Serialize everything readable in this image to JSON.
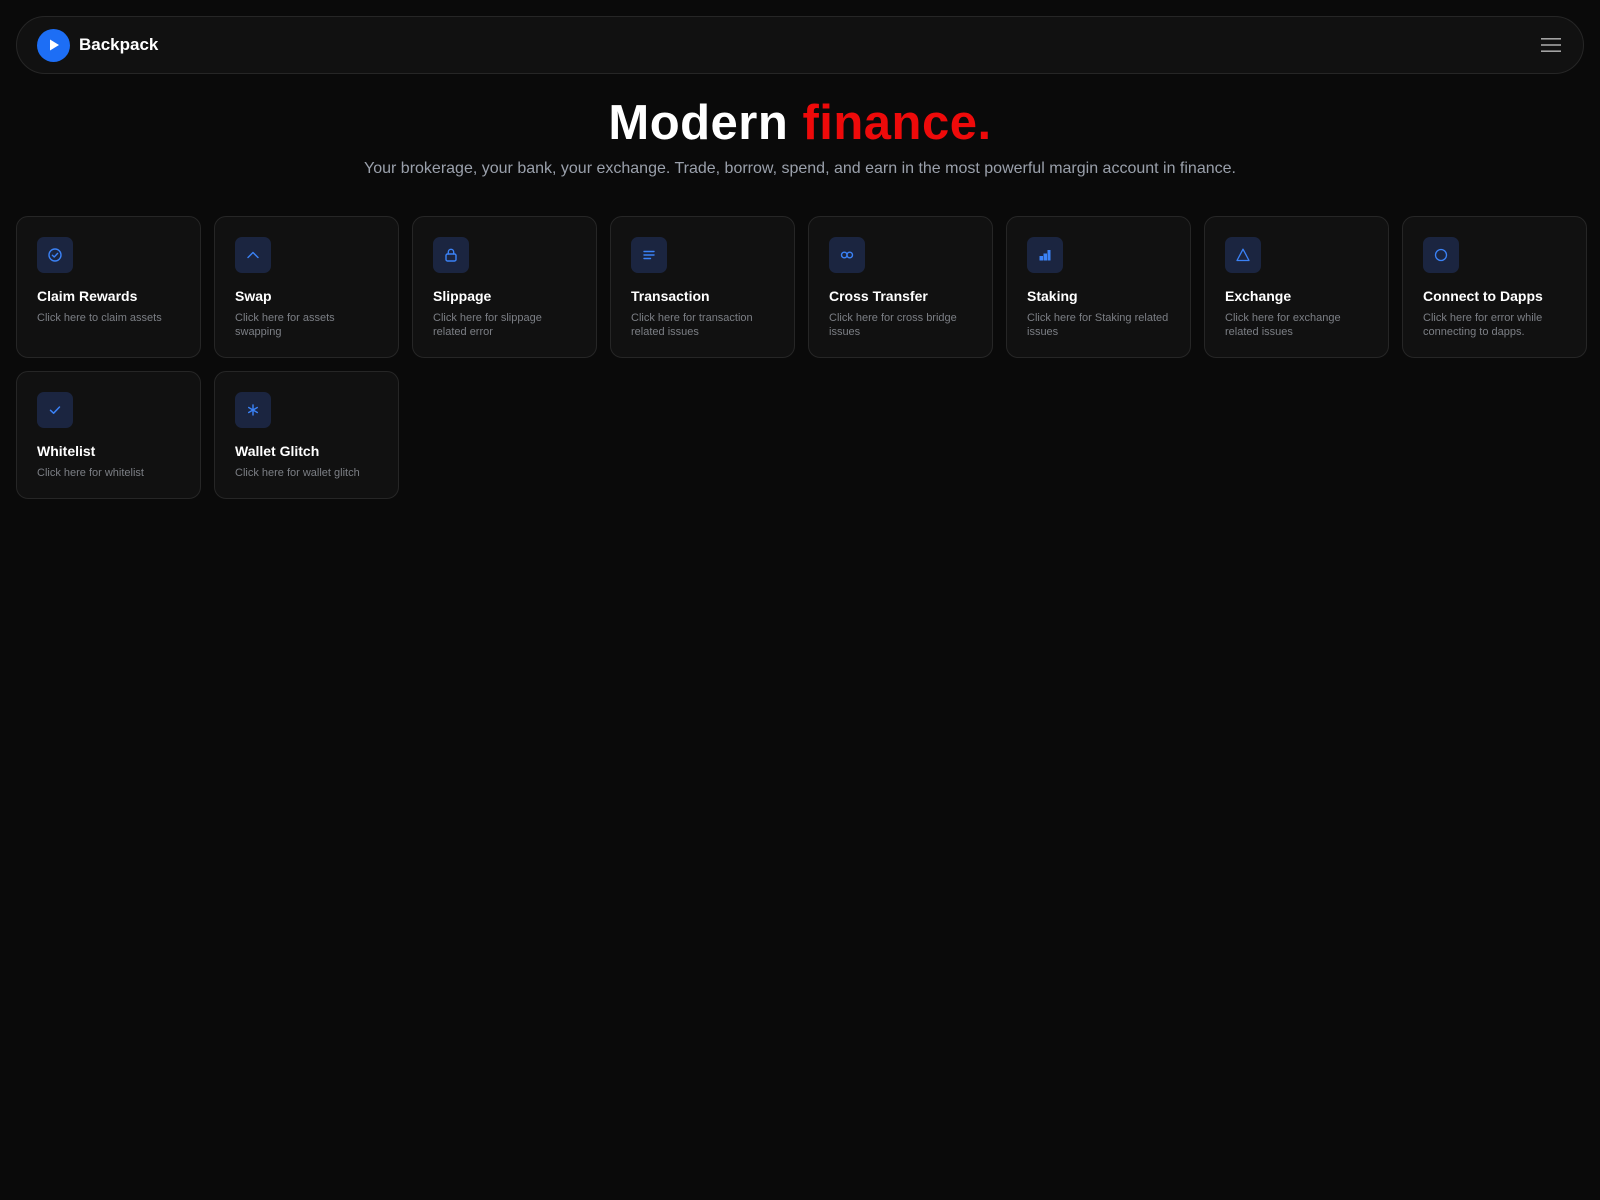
{
  "header": {
    "brand": "Backpack"
  },
  "hero": {
    "title_part1": "Modern",
    "title_part2": "finance.",
    "subtitle": "Your brokerage, your bank, your exchange. Trade, borrow, spend, and earn in the most powerful margin account in finance."
  },
  "colors": {
    "accent_blue": "#1d6ef5",
    "highlight_red": "#ee0a0a",
    "background": "#0a0a0a",
    "card_bg": "#111111",
    "icon_bg": "#1b2540",
    "icon_fg": "#3b82f6"
  },
  "cards": [
    {
      "title": "Claim Rewards",
      "description": "Click here to claim assets",
      "icon": "check-circle-icon"
    },
    {
      "title": "Swap",
      "description": "Click here for assets swapping",
      "icon": "chevron-up-icon"
    },
    {
      "title": "Slippage",
      "description": "Click here for slippage related error",
      "icon": "lock-icon"
    },
    {
      "title": "Transaction",
      "description": "Click here for transaction related issues",
      "icon": "lines-icon"
    },
    {
      "title": "Cross Transfer",
      "description": "Click here for cross bridge issues",
      "icon": "infinity-icon"
    },
    {
      "title": "Staking",
      "description": "Click here for Staking related issues",
      "icon": "bar-chart-icon"
    },
    {
      "title": "Exchange",
      "description": "Click here for exchange related issues",
      "icon": "triangle-icon"
    },
    {
      "title": "Connect to Dapps",
      "description": "Click here for error while connecting to dapps.",
      "icon": "circle-icon"
    },
    {
      "title": "Whitelist",
      "description": "Click here for whitelist",
      "icon": "check-icon"
    },
    {
      "title": "Wallet Glitch",
      "description": "Click here for wallet glitch",
      "icon": "asterisk-icon"
    }
  ]
}
